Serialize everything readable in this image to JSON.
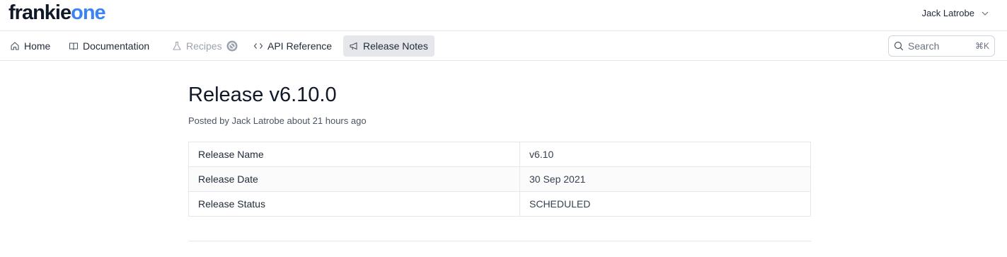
{
  "brand": {
    "part1": "frankie",
    "part2": "one",
    "color_dark": "#111827",
    "color_accent": "#3b82f6"
  },
  "user": {
    "name": "Jack Latrobe",
    "icon": "chevron-down-icon"
  },
  "nav": {
    "home": {
      "label": "Home",
      "icon": "home-icon"
    },
    "documentation": {
      "label": "Documentation",
      "icon": "book-icon"
    },
    "recipes": {
      "label": "Recipes",
      "icon": "flask-icon",
      "badge_icon": "disabled-icon"
    },
    "api_reference": {
      "label": "API Reference",
      "icon": "code-icon"
    },
    "release_notes": {
      "label": "Release Notes",
      "icon": "megaphone-icon"
    }
  },
  "search": {
    "label": "Search",
    "shortcut": "⌘K",
    "icon": "search-icon"
  },
  "page": {
    "title": "Release v6.10.0",
    "posted_prefix": "Posted by",
    "author": "Jack Latrobe",
    "time": "about 21 hours ago"
  },
  "release_table": [
    {
      "key": "Release Name",
      "value": "v6.10"
    },
    {
      "key": "Release Date",
      "value": "30 Sep 2021"
    },
    {
      "key": "Release Status",
      "value": "SCHEDULED"
    }
  ]
}
